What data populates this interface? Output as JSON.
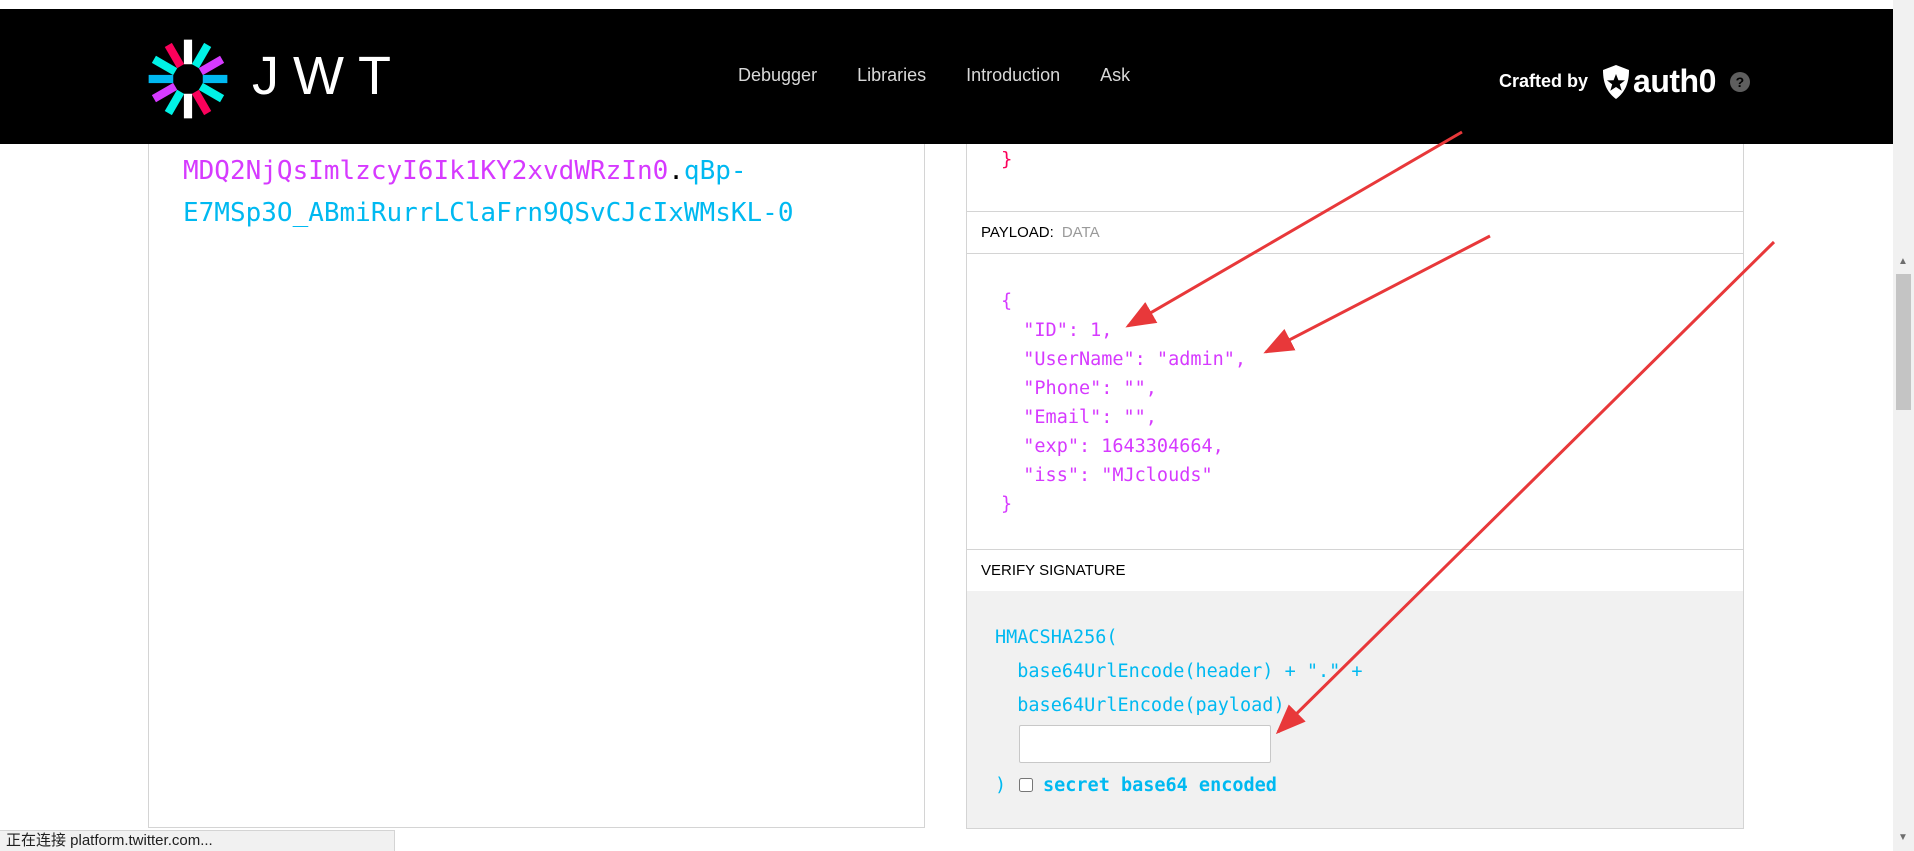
{
  "nav": {
    "brand": "JWT",
    "links": [
      "Debugger",
      "Libraries",
      "Introduction",
      "Ask"
    ],
    "crafted_by": "Crafted by",
    "partner": "auth0",
    "help": "?"
  },
  "encoded": {
    "payload_part": "MDQ2NjQsImlzcyI6Ik1KY2xvdWRzIn0",
    "dot": ".",
    "signature_line1": "qBp-",
    "signature_line2": "E7MSp3O_ABmiRurrLClaFrn9QSvCJcIxWMsKL-0"
  },
  "decoded": {
    "header_tail": "}",
    "payload_label": "PAYLOAD:",
    "payload_sub": "DATA",
    "payload_lines": [
      "{",
      "  \"ID\": 1,",
      "  \"UserName\": \"admin\",",
      "  \"Phone\": \"\",",
      "  \"Email\": \"\",",
      "  \"exp\": 1643304664,",
      "  \"iss\": \"MJclouds\"",
      "}"
    ],
    "verify_label": "VERIFY SIGNATURE",
    "sig_lines": [
      "HMACSHA256(",
      "  base64UrlEncode(header) + \".\" +",
      "  base64UrlEncode(payload),"
    ],
    "secret_value": "",
    "sig_close": ")",
    "b64_label": "secret base64 encoded"
  },
  "status": {
    "text": "正在连接 platform.twitter.com..."
  },
  "colors": {
    "payload": "#d63aff",
    "signature": "#00b9f1",
    "header": "#fb015b",
    "annotation_arrow": "#e8383a"
  }
}
